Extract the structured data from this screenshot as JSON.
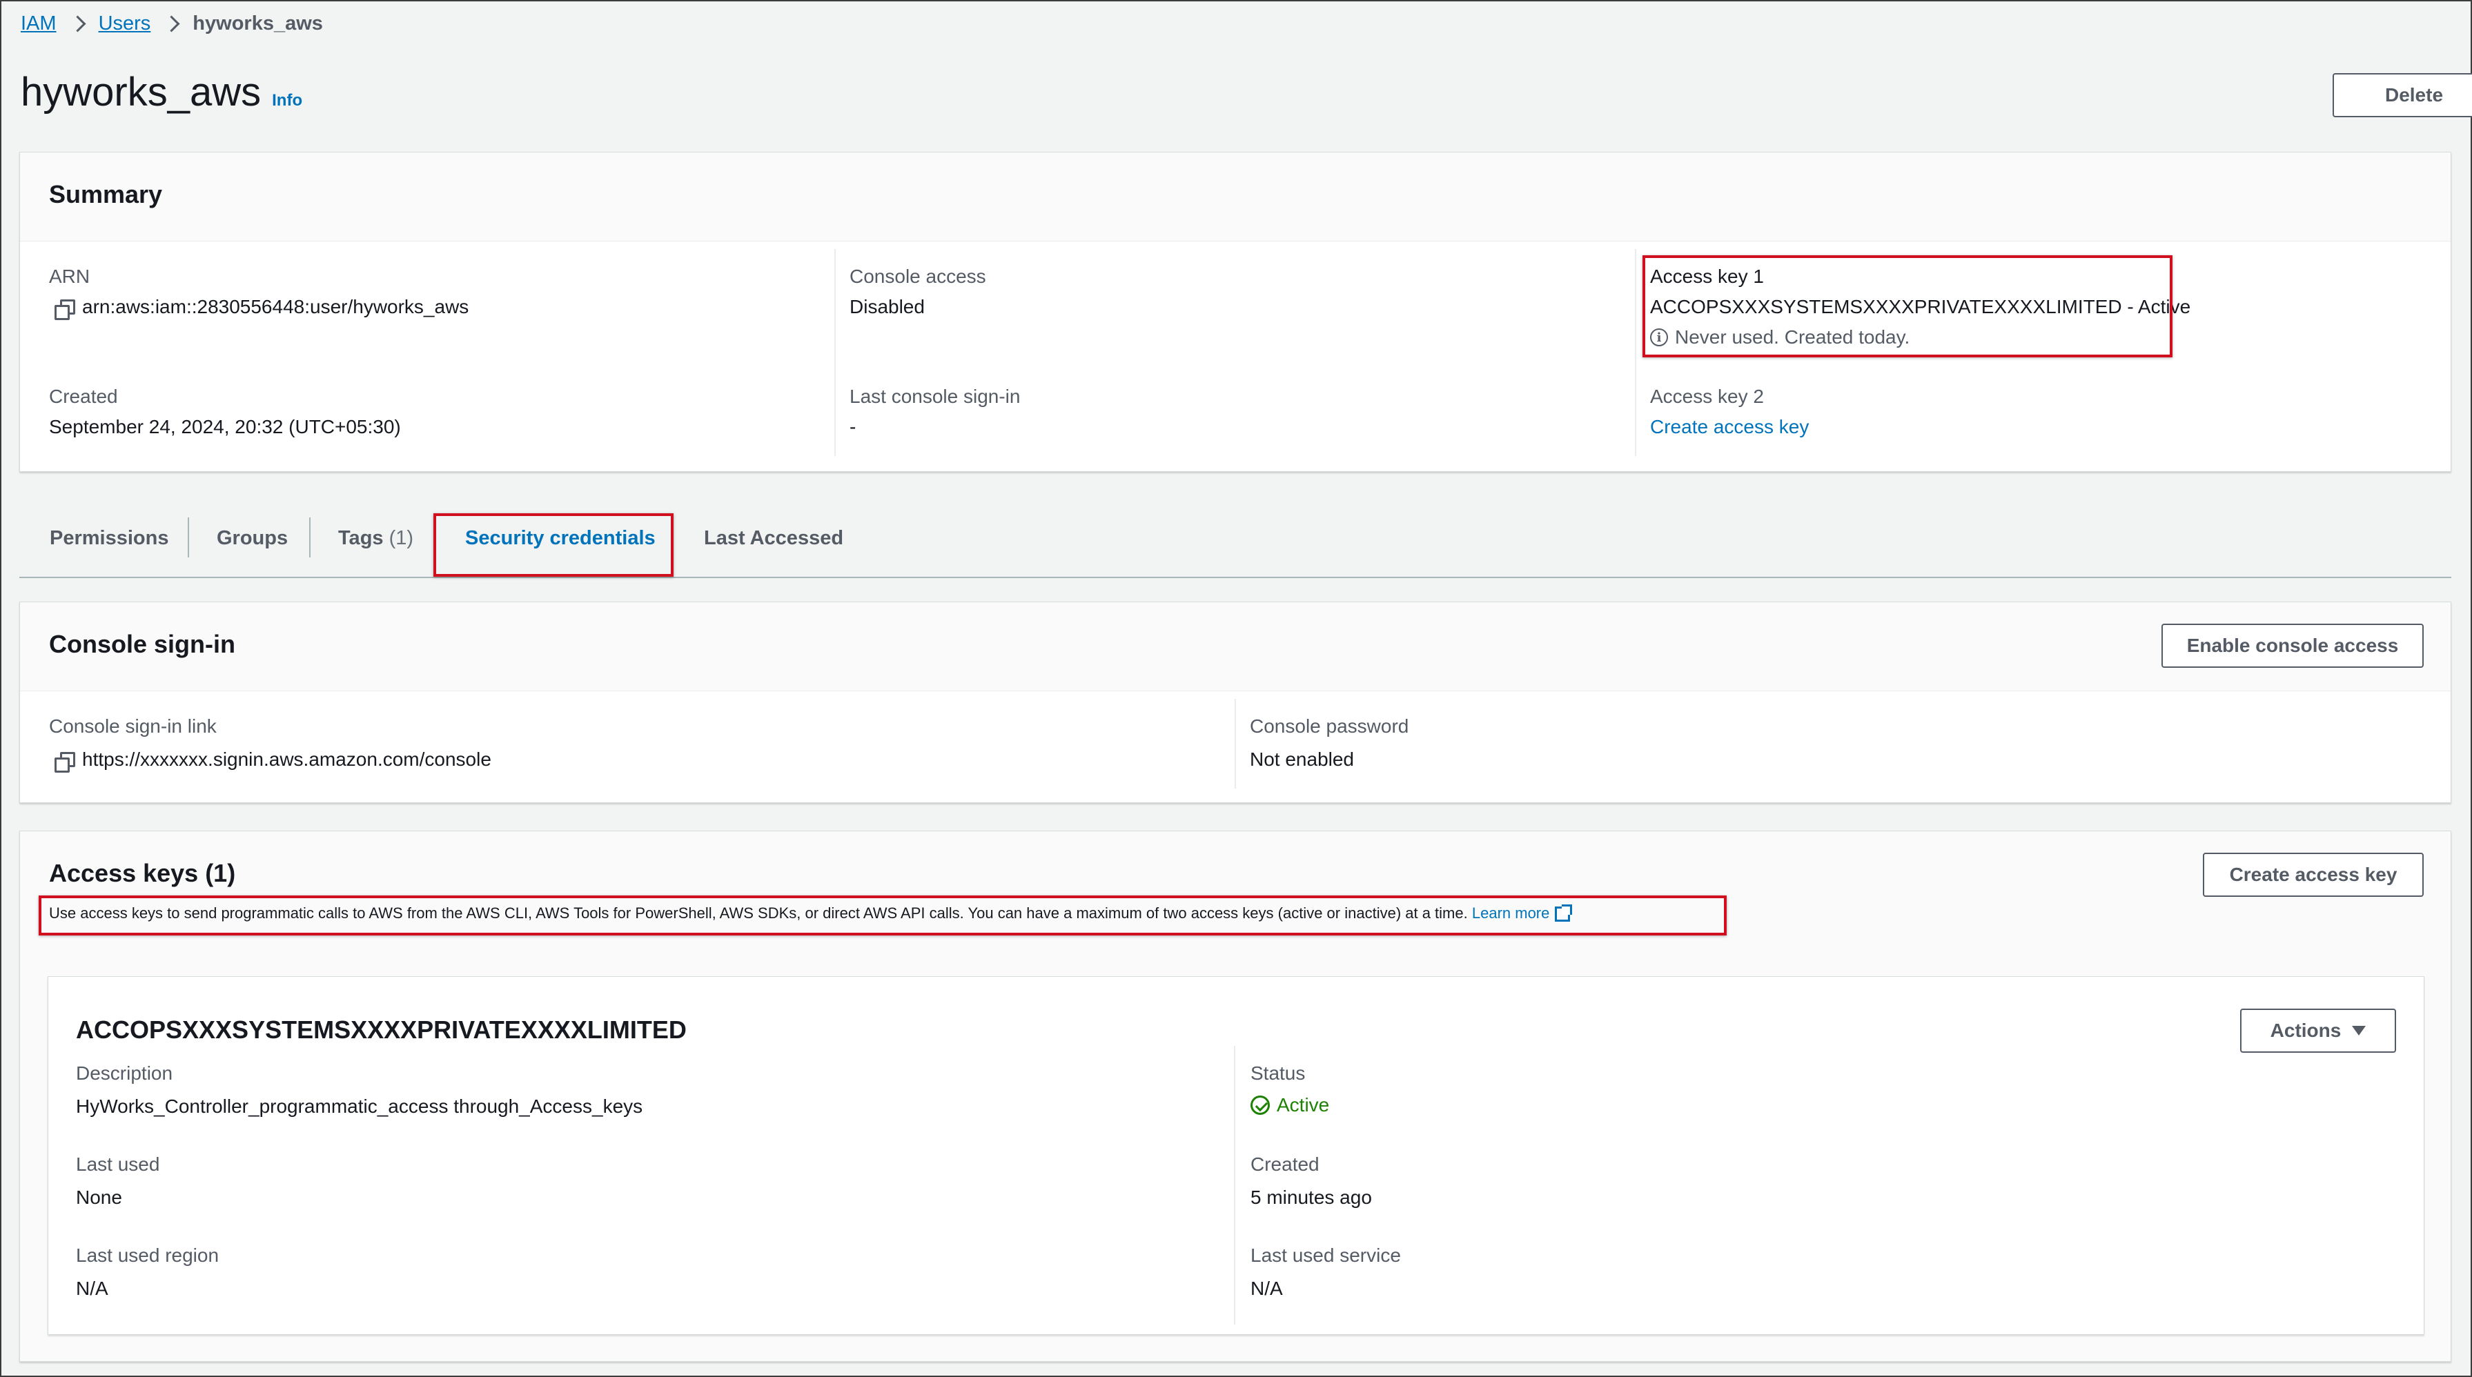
{
  "breadcrumb": {
    "items": [
      {
        "label": "IAM"
      },
      {
        "label": "Users"
      }
    ],
    "current": "hyworks_aws"
  },
  "page": {
    "title": "hyworks_aws",
    "info_label": "Info",
    "delete_label": "Delete"
  },
  "summary": {
    "title": "Summary",
    "arn_label": "ARN",
    "arn_value": "arn:aws:iam::2830556448:user/hyworks_aws",
    "created_label": "Created",
    "created_value": "September 24, 2024, 20:32 (UTC+05:30)",
    "console_access_label": "Console access",
    "console_access_value": "Disabled",
    "last_signin_label": "Last console sign-in",
    "last_signin_value": "-",
    "access_key1_label": "Access key 1",
    "access_key1_value": "ACCOPSXXXSYSTEMSXXXXPRIVATEXXXXLIMITED - Active",
    "access_key1_note": "Never used. Created today.",
    "access_key2_label": "Access key 2",
    "access_key2_link": "Create access key"
  },
  "tabs": [
    {
      "label": "Permissions"
    },
    {
      "label": "Groups"
    },
    {
      "label": "Tags",
      "count": "(1)"
    },
    {
      "label": "Security credentials",
      "active": true
    },
    {
      "label": "Last Accessed"
    }
  ],
  "console_signin": {
    "title": "Console sign-in",
    "enable_button": "Enable console access",
    "link_label": "Console sign-in link",
    "link_value": "https://xxxxxxx.signin.aws.amazon.com/console",
    "password_label": "Console password",
    "password_value": "Not enabled"
  },
  "access_keys": {
    "title": "Access keys (1)",
    "create_button": "Create access key",
    "description": "Use access keys to send programmatic calls to AWS from the AWS CLI, AWS Tools for PowerShell, AWS SDKs, or direct AWS API calls. You can have a maximum of two access keys (active or inactive) at a time.",
    "learn_more": "Learn more",
    "key": {
      "id": "ACCOPSXXXSYSTEMSXXXXPRIVATEXXXXLIMITED",
      "actions_label": "Actions",
      "description_label": "Description",
      "description_value": "HyWorks_Controller_programmatic_access through_Access_keys",
      "status_label": "Status",
      "status_value": "Active",
      "last_used_label": "Last used",
      "last_used_value": "None",
      "created_label": "Created",
      "created_value": "5 minutes ago",
      "last_used_region_label": "Last used region",
      "last_used_region_value": "N/A",
      "last_used_service_label": "Last used service",
      "last_used_service_value": "N/A"
    }
  },
  "colors": {
    "link": "#0073bb",
    "active_status": "#1d8102",
    "highlight": "#d0101f",
    "background": "#f2f3f3"
  },
  "icons": [
    "chevron-right-icon",
    "copy-icon",
    "info-icon",
    "check-circle-icon",
    "external-link-icon",
    "caret-down-icon"
  ]
}
